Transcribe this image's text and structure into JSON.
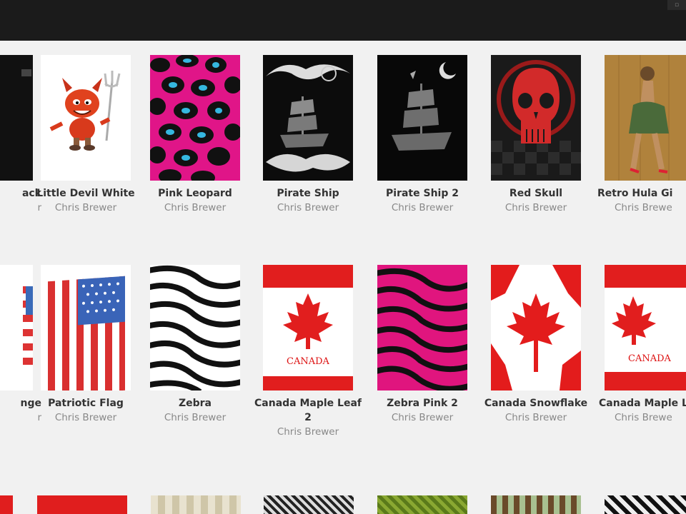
{
  "header": {
    "title": ""
  },
  "row1": [
    {
      "title": "ack",
      "author": "r",
      "partial": "left"
    },
    {
      "title": "Little Devil White",
      "author": "Chris Brewer"
    },
    {
      "title": "Pink Leopard",
      "author": "Chris Brewer"
    },
    {
      "title": "Pirate Ship",
      "author": "Chris Brewer"
    },
    {
      "title": "Pirate Ship 2",
      "author": "Chris Brewer"
    },
    {
      "title": "Red Skull",
      "author": "Chris Brewer"
    },
    {
      "title": "Retro Hula Gi",
      "author": "Chris Brewe",
      "partial": "right"
    }
  ],
  "row2": [
    {
      "title": "nge",
      "author": "r",
      "partial": "left"
    },
    {
      "title": "Patriotic Flag",
      "author": "Chris Brewer"
    },
    {
      "title": "Zebra",
      "author": "Chris Brewer"
    },
    {
      "title": "Canada Maple Leaf 2",
      "author": "Chris Brewer"
    },
    {
      "title": "Zebra Pink 2",
      "author": "Chris Brewer"
    },
    {
      "title": "Canada Snowflake",
      "author": "Chris Brewer"
    },
    {
      "title": "Canada Maple Leaf",
      "author": "Chris Brewe",
      "partial": "right"
    }
  ],
  "canada_text": "CANADA",
  "colors": {
    "topbar": "#1b1b1b",
    "accent_red": "#e01e1e",
    "pink": "#e0157e"
  }
}
